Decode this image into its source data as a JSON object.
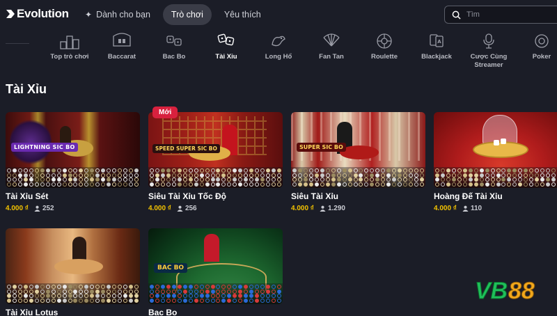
{
  "header": {
    "brand": "Evolution",
    "nav": [
      {
        "label": "Dành cho bạn",
        "icon": "sparkle-icon",
        "active": false
      },
      {
        "label": "Trò chơi",
        "active": true
      },
      {
        "label": "Yêu thích",
        "active": false
      }
    ],
    "search": {
      "placeholder": "Tìm",
      "value": ""
    }
  },
  "categories": [
    {
      "label": "Top trò chơi",
      "icon": "top-games-icon"
    },
    {
      "label": "Baccarat",
      "icon": "baccarat-icon"
    },
    {
      "label": "Bac Bo",
      "icon": "bac-bo-icon"
    },
    {
      "label": "Tài Xỉu",
      "icon": "dice-icon",
      "active": true
    },
    {
      "label": "Long Hổ",
      "icon": "dragon-tiger-icon"
    },
    {
      "label": "Fan Tan",
      "icon": "fan-tan-icon"
    },
    {
      "label": "Roulette",
      "icon": "roulette-icon"
    },
    {
      "label": "Blackjack",
      "icon": "blackjack-icon"
    },
    {
      "label": "Cược Cùng Streamer",
      "icon": "streamer-icon"
    },
    {
      "label": "Poker",
      "icon": "poker-icon"
    }
  ],
  "section": {
    "title": "Tài Xỉu"
  },
  "games": [
    {
      "name": "Tài Xỉu Sét",
      "bet": "4.000 ₫",
      "players": "252",
      "badge": "",
      "thumb_logo": "LIGHTNING SIC BO"
    },
    {
      "name": "Siêu Tài Xỉu Tốc Độ",
      "bet": "4.000 ₫",
      "players": "256",
      "badge": "Mới",
      "thumb_logo": "SPEED SUPER SIC BO"
    },
    {
      "name": "Siêu Tài Xỉu",
      "bet": "4.000 ₫",
      "players": "1.290",
      "badge": "",
      "thumb_logo": "SUPER SIC BO"
    },
    {
      "name": "Hoàng Đế Tài Xỉu",
      "bet": "4.000 ₫",
      "players": "110",
      "badge": "",
      "thumb_logo": ""
    },
    {
      "name": "Tài Xỉu Lotus",
      "bet": "",
      "players": "",
      "badge": "",
      "thumb_logo": ""
    },
    {
      "name": "Bac Bo",
      "bet": "",
      "players": "",
      "badge": "",
      "thumb_logo": "BAC BO"
    }
  ],
  "watermark": {
    "text_vb": "VB",
    "text_num": "88"
  },
  "colors": {
    "background": "#1b1d27",
    "bet_yellow": "#f2c200",
    "badge_red": "#d8213e",
    "nav_active": "#3a3c47"
  }
}
